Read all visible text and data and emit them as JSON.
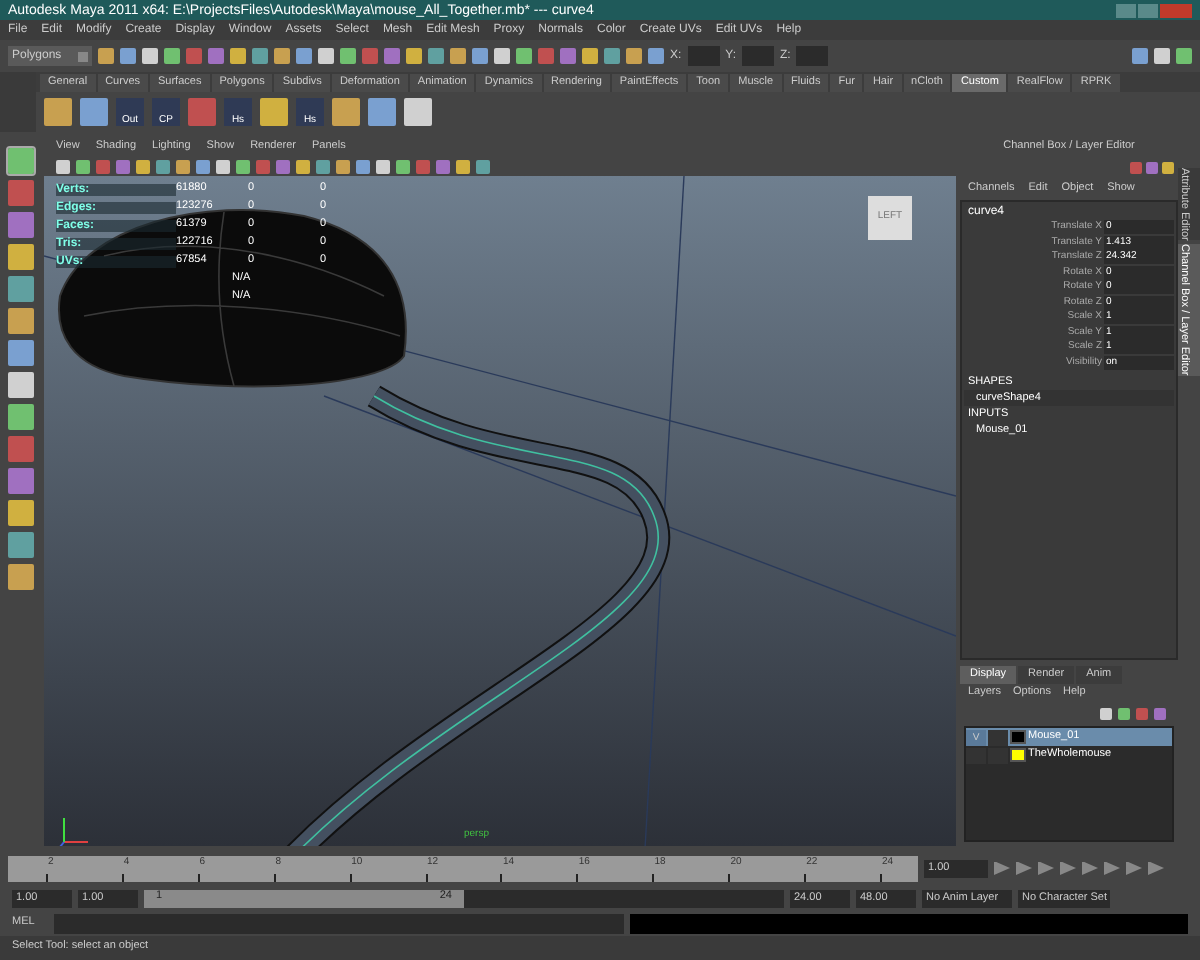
{
  "window": {
    "title": "Autodesk Maya 2011 x64: E:\\ProjectsFiles\\Autodesk\\Maya\\mouse_All_Together.mb*  ---  curve4"
  },
  "menu": [
    "File",
    "Edit",
    "Modify",
    "Create",
    "Display",
    "Window",
    "Assets",
    "Select",
    "Mesh",
    "Edit Mesh",
    "Proxy",
    "Normals",
    "Color",
    "Create UVs",
    "Edit UVs",
    "Help"
  ],
  "status_line": {
    "menu_set": "Polygons",
    "x_label": "X:",
    "y_label": "Y:",
    "z_label": "Z:"
  },
  "shelf_tabs": [
    {
      "label": "General",
      "selected": false
    },
    {
      "label": "Curves",
      "selected": false
    },
    {
      "label": "Surfaces",
      "selected": false
    },
    {
      "label": "Polygons",
      "selected": false
    },
    {
      "label": "Subdivs",
      "selected": false
    },
    {
      "label": "Deformation",
      "selected": false
    },
    {
      "label": "Animation",
      "selected": false
    },
    {
      "label": "Dynamics",
      "selected": false
    },
    {
      "label": "Rendering",
      "selected": false
    },
    {
      "label": "PaintEffects",
      "selected": false
    },
    {
      "label": "Toon",
      "selected": false
    },
    {
      "label": "Muscle",
      "selected": false
    },
    {
      "label": "Fluids",
      "selected": false
    },
    {
      "label": "Fur",
      "selected": false
    },
    {
      "label": "Hair",
      "selected": false
    },
    {
      "label": "nCloth",
      "selected": false
    },
    {
      "label": "Custom",
      "selected": true
    },
    {
      "label": "RealFlow",
      "selected": false
    },
    {
      "label": "RPRK",
      "selected": false
    }
  ],
  "shelf_buttons": [
    {
      "kind": "icon"
    },
    {
      "kind": "icon"
    },
    {
      "kind": "labeled",
      "label": "Out"
    },
    {
      "kind": "labeled",
      "label": "CP"
    },
    {
      "kind": "icon"
    },
    {
      "kind": "labeled",
      "label": "Hs"
    },
    {
      "kind": "icon"
    },
    {
      "kind": "labeled",
      "label": "Hs"
    },
    {
      "kind": "icon"
    },
    {
      "kind": "icon"
    },
    {
      "kind": "icon"
    }
  ],
  "viewport": {
    "menu": [
      "View",
      "Shading",
      "Lighting",
      "Show",
      "Renderer",
      "Panels"
    ],
    "hud": [
      {
        "label": "Verts:",
        "values": [
          "61880",
          "0",
          "0"
        ]
      },
      {
        "label": "Edges:",
        "values": [
          "123276",
          "0",
          "0"
        ]
      },
      {
        "label": "Faces:",
        "values": [
          "61379",
          "0",
          "0"
        ]
      },
      {
        "label": "Tris:",
        "values": [
          "122716",
          "0",
          "0"
        ]
      },
      {
        "label": "UVs:",
        "values": [
          "67854",
          "0",
          "0"
        ]
      },
      {
        "values": [
          "N/A"
        ]
      },
      {
        "values": [
          "N/A"
        ]
      }
    ],
    "view_cube": "LEFT",
    "camera": "persp"
  },
  "channel_box": {
    "title": "Channel Box / Layer Editor",
    "menu": [
      "Channels",
      "Edit",
      "Object",
      "Show"
    ],
    "object": "curve4",
    "channels": [
      {
        "name": "Translate X",
        "value": "0"
      },
      {
        "name": "Translate Y",
        "value": "1.413"
      },
      {
        "name": "Translate Z",
        "value": "24.342"
      },
      {
        "name": "Rotate X",
        "value": "0"
      },
      {
        "name": "Rotate Y",
        "value": "0"
      },
      {
        "name": "Rotate Z",
        "value": "0"
      },
      {
        "name": "Scale X",
        "value": "1"
      },
      {
        "name": "Scale Y",
        "value": "1"
      },
      {
        "name": "Scale Z",
        "value": "1"
      },
      {
        "name": "Visibility",
        "value": "on"
      }
    ],
    "shapes_heading": "SHAPES",
    "shape": "curveShape4",
    "inputs_heading": "INPUTS",
    "input": "Mouse_01"
  },
  "side_tabs": [
    {
      "label": "Attribute Editor",
      "selected": false
    },
    {
      "label": "Channel Box / Layer Editor",
      "selected": true
    }
  ],
  "layer_editor": {
    "tabs": [
      {
        "label": "Display",
        "selected": true
      },
      {
        "label": "Render",
        "selected": false
      },
      {
        "label": "Anim",
        "selected": false
      }
    ],
    "menu": [
      "Layers",
      "Options",
      "Help"
    ],
    "layers": [
      {
        "name": "Mouse_01",
        "visible_mark": "V",
        "color": "#000000",
        "selected": true
      },
      {
        "name": "TheWholemouse",
        "color": "#ffff00",
        "selected": false
      }
    ]
  },
  "time_slider": {
    "ticks": [
      "2",
      "4",
      "6",
      "8",
      "10",
      "12",
      "14",
      "16",
      "18",
      "20",
      "22",
      "24"
    ],
    "current": "1.00"
  },
  "range_slider": {
    "start": "1.00",
    "playback_start": "1.00",
    "range_start": "1",
    "range_end": "24",
    "playback_end": "24.00",
    "end": "48.00",
    "anim_layer": "No Anim Layer",
    "character_set": "No Character Set"
  },
  "command_line": {
    "label": "MEL"
  },
  "help_line": "Select Tool: select an object"
}
